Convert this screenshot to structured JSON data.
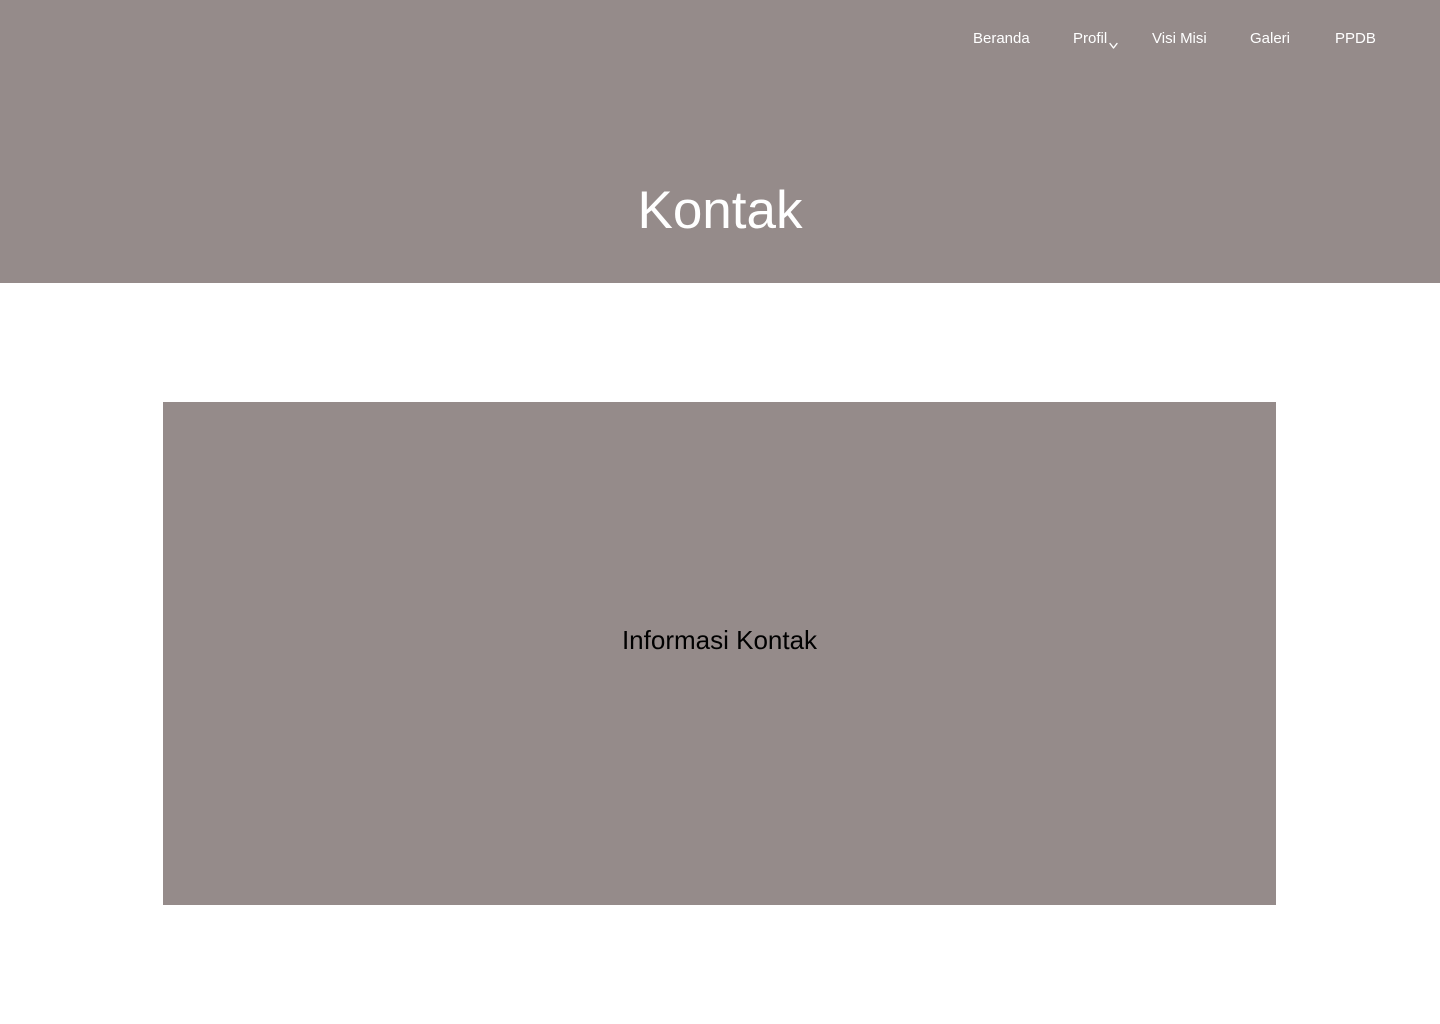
{
  "colors": {
    "hero_background": "#958b8a",
    "card_background": "#958b8a",
    "page_background": "#ffffff",
    "nav_text": "#ffffff",
    "title_text": "#ffffff",
    "card_text": "#000000"
  },
  "nav": {
    "items": [
      {
        "label": "Beranda"
      },
      {
        "label": "Profil",
        "icon": "chevron-down-icon"
      },
      {
        "label": "Visi Misi"
      },
      {
        "label": "Galeri"
      },
      {
        "label": "PPDB"
      }
    ]
  },
  "hero": {
    "title": "Kontak"
  },
  "contact_card": {
    "title": "Informasi Kontak"
  }
}
